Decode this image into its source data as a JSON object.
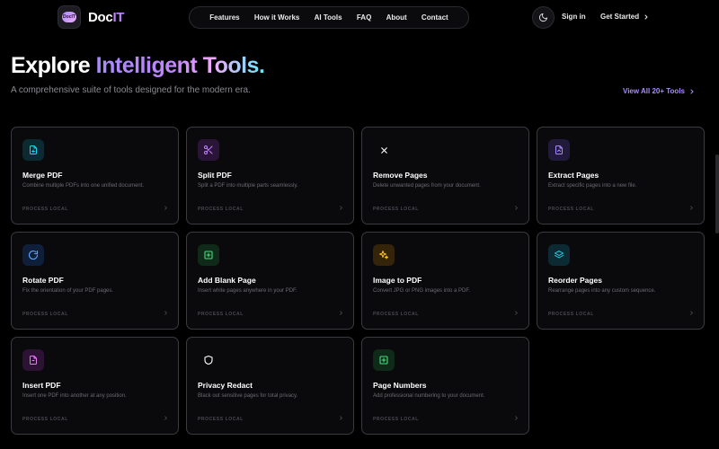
{
  "brand": {
    "name_a": "Doc",
    "name_b": "IT",
    "badge": "DocIT"
  },
  "nav": [
    {
      "label": "Features"
    },
    {
      "label": "How it Works"
    },
    {
      "label": "AI Tools"
    },
    {
      "label": "FAQ"
    },
    {
      "label": "About"
    },
    {
      "label": "Contact"
    }
  ],
  "header": {
    "signin": "Sign in",
    "get_started": "Get Started"
  },
  "hero": {
    "title_plain": "Explore",
    "title_grad": "Intelligent Tools.",
    "subtitle": "A comprehensive suite of tools designed for the modern era.",
    "view_all": "View All 20+ Tools"
  },
  "tools": [
    {
      "title": "Merge PDF",
      "desc": "Combine multiple PDFs into one unified document.",
      "foot": "PROCESS LOCAL",
      "icon": "merge-icon",
      "color": "#22d3ee",
      "bg": "#0b2a32"
    },
    {
      "title": "Split PDF",
      "desc": "Split a PDF into multiple parts seamlessly.",
      "foot": "PROCESS LOCAL",
      "icon": "scissors-icon",
      "color": "#c084fc",
      "bg": "#2a1538"
    },
    {
      "title": "Remove Pages",
      "desc": "Delete unwanted pages from your document.",
      "foot": "PROCESS LOCAL",
      "icon": "close-icon",
      "color": "#ffffff",
      "bg": "#0a0a0c"
    },
    {
      "title": "Extract Pages",
      "desc": "Extract specific pages into a new file.",
      "foot": "PROCESS LOCAL",
      "icon": "extract-icon",
      "color": "#a78bfa",
      "bg": "#221a3a"
    },
    {
      "title": "Rotate PDF",
      "desc": "Fix the orientation of your PDF pages.",
      "foot": "PROCESS LOCAL",
      "icon": "rotate-icon",
      "color": "#60a5fa",
      "bg": "#0f1f3a"
    },
    {
      "title": "Add Blank Page",
      "desc": "Insert white pages anywhere in your PDF.",
      "foot": "PROCESS LOCAL",
      "icon": "plus-square-icon",
      "color": "#4ade80",
      "bg": "#0f2a18"
    },
    {
      "title": "Image to PDF",
      "desc": "Convert JPG or PNG images into a PDF.",
      "foot": "PROCESS LOCAL",
      "icon": "sparkle-icon",
      "color": "#fbbf24",
      "bg": "#33240a"
    },
    {
      "title": "Reorder Pages",
      "desc": "Rearrange pages into any custom sequence.",
      "foot": "PROCESS LOCAL",
      "icon": "layers-icon",
      "color": "#22d3ee",
      "bg": "#0b2a32"
    },
    {
      "title": "Insert PDF",
      "desc": "Insert one PDF into another at any position.",
      "foot": "PROCESS LOCAL",
      "icon": "file-insert-icon",
      "color": "#e879f9",
      "bg": "#2e1236"
    },
    {
      "title": "Privacy Redact",
      "desc": "Black out sensitive pages for total privacy.",
      "foot": "PROCESS LOCAL",
      "icon": "shield-icon",
      "color": "#ffffff",
      "bg": "#0a0a0c"
    },
    {
      "title": "Page Numbers",
      "desc": "Add professional numbering to your document.",
      "foot": "PROCESS LOCAL",
      "icon": "plus-square-icon",
      "color": "#4ade80",
      "bg": "#0f2a18"
    }
  ]
}
